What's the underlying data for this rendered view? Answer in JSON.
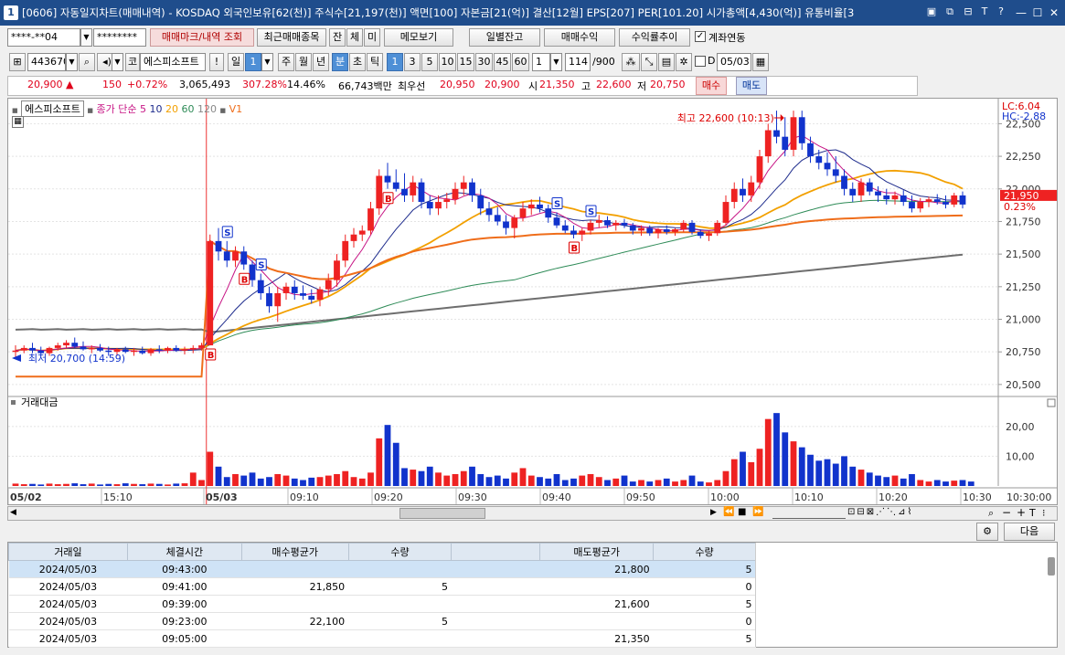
{
  "title": {
    "text": "[0606] 자동일지차트(매매내역) - KOSDAQ 외국인보유[62(천)] 주식수[21,197(천)] 액면[100] 자본금[21(억)] 결산[12월] EPS[207] PER[101.20] 시가총액[4,430(억)] 유통비율[3",
    "app_number": "1"
  },
  "toolbar1": {
    "account": "****-**04",
    "password": "********",
    "btn_markers": "매매마크/내역 조회",
    "btn_recent": "최근매매종목",
    "btn_jan": "잔",
    "btn_che": "체",
    "btn_mi": "미",
    "btn_memo": "메모보기",
    "btn_daily": "일별잔고",
    "btn_profit": "매매수익",
    "btn_return": "수익률추이",
    "link_label": "계좌연동"
  },
  "toolbar2": {
    "code": "443670",
    "market": "코",
    "stock_name": "에스피소프트",
    "excl": "!",
    "day_label": "일",
    "day_val": "1",
    "week": "주",
    "month": "월",
    "year": "년",
    "minute": "분",
    "sec": "초",
    "tick": "틱",
    "periods": [
      "1",
      "3",
      "5",
      "10",
      "15",
      "30",
      "45",
      "60"
    ],
    "count": "1",
    "bars": "114",
    "total_bars": "/900",
    "d_label": "D",
    "date": "05/03"
  },
  "pricebar": {
    "price": "20,900",
    "arrow": "▲",
    "change": "150",
    "pct": "+0.72%",
    "volume": "3,065,493",
    "vol_ratio": "307.28%",
    "turnover": "14.46%",
    "amount": "66,743백만",
    "best_label": "최우선",
    "ask": "20,950",
    "bid": "20,900",
    "open_label": "시",
    "open": "21,350",
    "high_label": "고",
    "high": "22,600",
    "low_label": "저",
    "low": "20,750",
    "buy": "매수",
    "sell": "매도"
  },
  "chart_header": {
    "stock": "에스피소프트",
    "ma_label": "종가 단순",
    "ma": [
      "5",
      "10",
      "20",
      "60",
      "120"
    ],
    "v1": "V1",
    "lc": "LC:6.04",
    "hc": "HC:-2.88",
    "high_note": "최고 22,600 (10:13)",
    "low_note": "최저 20,700 (14:59)",
    "cur_price": "21,950",
    "cur_pct": "0.23%",
    "vol_title": "거래대금"
  },
  "colors": {
    "up": "#ee2222",
    "down": "#1133cc",
    "ma5": "#c71585",
    "ma10": "#1d2b8c",
    "ma20": "#f2a000",
    "ma60": "#2e8b57",
    "ma120": "#6e6e6e",
    "vwap": "#ef6d1a"
  },
  "chart_data": {
    "type": "candlestick",
    "y_ticks": [
      "22,500",
      "22,250",
      "22,000",
      "21,750",
      "21,500",
      "21,250",
      "21,000",
      "20,750",
      "20,500"
    ],
    "ylim": [
      20450,
      22650
    ],
    "vol_ticks": [
      "20,00",
      "10,00"
    ],
    "x_ticks": [
      "05/02",
      "15:10",
      "05/03",
      "09:10",
      "09:20",
      "09:30",
      "09:40",
      "09:50",
      "10:00",
      "10:10",
      "10:20",
      "10:30",
      "10:30:00"
    ],
    "candles": [
      [
        20750,
        20800,
        20700,
        20760
      ],
      [
        20760,
        20800,
        20740,
        20780
      ],
      [
        20780,
        20820,
        20740,
        20760
      ],
      [
        20760,
        20790,
        20720,
        20740
      ],
      [
        20740,
        20790,
        20720,
        20780
      ],
      [
        20780,
        20820,
        20760,
        20800
      ],
      [
        20800,
        20840,
        20780,
        20820
      ],
      [
        20820,
        20860,
        20780,
        20790
      ],
      [
        20790,
        20830,
        20760,
        20770
      ],
      [
        20770,
        20800,
        20740,
        20780
      ],
      [
        20780,
        20810,
        20750,
        20760
      ],
      [
        20760,
        20790,
        20720,
        20750
      ],
      [
        20750,
        20780,
        20720,
        20770
      ],
      [
        20770,
        20790,
        20740,
        20750
      ],
      [
        20750,
        20780,
        20720,
        20760
      ],
      [
        20760,
        20790,
        20730,
        20740
      ],
      [
        20740,
        20780,
        20720,
        20770
      ],
      [
        20770,
        20800,
        20740,
        20760
      ],
      [
        20760,
        20790,
        20740,
        20780
      ],
      [
        20780,
        20800,
        20750,
        20760
      ],
      [
        20760,
        20790,
        20730,
        20770
      ],
      [
        20770,
        20800,
        20740,
        20780
      ],
      [
        20780,
        20820,
        20760,
        20800
      ],
      [
        20800,
        21650,
        20800,
        21600
      ],
      [
        21600,
        21700,
        21450,
        21520
      ],
      [
        21520,
        21600,
        21400,
        21450
      ],
      [
        21450,
        21560,
        21400,
        21520
      ],
      [
        21520,
        21560,
        21380,
        21420
      ],
      [
        21420,
        21450,
        21250,
        21300
      ],
      [
        21300,
        21350,
        21150,
        21200
      ],
      [
        21200,
        21250,
        21050,
        21100
      ],
      [
        21100,
        21250,
        20980,
        21200
      ],
      [
        21200,
        21280,
        21150,
        21250
      ],
      [
        21250,
        21300,
        21150,
        21200
      ],
      [
        21200,
        21260,
        21150,
        21180
      ],
      [
        21180,
        21230,
        21120,
        21150
      ],
      [
        21150,
        21250,
        21100,
        21230
      ],
      [
        21230,
        21350,
        21180,
        21300
      ],
      [
        21300,
        21500,
        21250,
        21450
      ],
      [
        21450,
        21650,
        21400,
        21600
      ],
      [
        21600,
        21700,
        21550,
        21650
      ],
      [
        21650,
        21720,
        21600,
        21680
      ],
      [
        21680,
        21900,
        21650,
        21850
      ],
      [
        21850,
        22150,
        21800,
        22100
      ],
      [
        22100,
        22200,
        22000,
        22050
      ],
      [
        22050,
        22150,
        21980,
        22000
      ],
      [
        22000,
        22120,
        21900,
        21950
      ],
      [
        21950,
        22100,
        21900,
        22050
      ],
      [
        22050,
        22080,
        21850,
        21900
      ],
      [
        21900,
        21950,
        21800,
        21850
      ],
      [
        21850,
        21950,
        21800,
        21900
      ],
      [
        21900,
        21970,
        21850,
        21920
      ],
      [
        21920,
        22050,
        21880,
        22000
      ],
      [
        22000,
        22100,
        21950,
        22050
      ],
      [
        22050,
        22080,
        21900,
        21950
      ],
      [
        21950,
        22000,
        21800,
        21850
      ],
      [
        21850,
        21900,
        21750,
        21800
      ],
      [
        21800,
        21860,
        21720,
        21750
      ],
      [
        21750,
        21800,
        21650,
        21700
      ],
      [
        21700,
        21800,
        21620,
        21780
      ],
      [
        21780,
        21900,
        21750,
        21850
      ],
      [
        21850,
        21920,
        21800,
        21880
      ],
      [
        21880,
        21940,
        21820,
        21850
      ],
      [
        21850,
        21880,
        21740,
        21780
      ],
      [
        21780,
        21820,
        21700,
        21720
      ],
      [
        21720,
        21760,
        21660,
        21680
      ],
      [
        21680,
        21720,
        21620,
        21650
      ],
      [
        21650,
        21700,
        21600,
        21680
      ],
      [
        21680,
        21760,
        21650,
        21740
      ],
      [
        21740,
        21800,
        21700,
        21760
      ],
      [
        21760,
        21790,
        21700,
        21720
      ],
      [
        21720,
        21760,
        21680,
        21740
      ],
      [
        21740,
        21770,
        21700,
        21720
      ],
      [
        21720,
        21740,
        21650,
        21680
      ],
      [
        21680,
        21720,
        21640,
        21700
      ],
      [
        21700,
        21720,
        21640,
        21660
      ],
      [
        21660,
        21700,
        21620,
        21690
      ],
      [
        21690,
        21720,
        21650,
        21670
      ],
      [
        21670,
        21700,
        21640,
        21690
      ],
      [
        21690,
        21760,
        21670,
        21740
      ],
      [
        21740,
        21760,
        21650,
        21670
      ],
      [
        21670,
        21690,
        21620,
        21640
      ],
      [
        21640,
        21680,
        21600,
        21660
      ],
      [
        21660,
        21760,
        21640,
        21740
      ],
      [
        21740,
        21950,
        21720,
        21900
      ],
      [
        21900,
        22050,
        21850,
        22000
      ],
      [
        22000,
        22080,
        21900,
        21950
      ],
      [
        21950,
        22100,
        21900,
        22050
      ],
      [
        22050,
        22300,
        22000,
        22250
      ],
      [
        22250,
        22500,
        22200,
        22450
      ],
      [
        22450,
        22600,
        22350,
        22400
      ],
      [
        22400,
        22550,
        22250,
        22300
      ],
      [
        22300,
        22600,
        22250,
        22550
      ],
      [
        22550,
        22600,
        22300,
        22350
      ],
      [
        22350,
        22400,
        22200,
        22250
      ],
      [
        22250,
        22300,
        22150,
        22200
      ],
      [
        22200,
        22280,
        22100,
        22150
      ],
      [
        22150,
        22250,
        22050,
        22100
      ],
      [
        22100,
        22150,
        21950,
        22000
      ],
      [
        22000,
        22050,
        21900,
        21950
      ],
      [
        21950,
        22080,
        21900,
        22050
      ],
      [
        22050,
        22080,
        21950,
        21980
      ],
      [
        21980,
        22020,
        21900,
        21950
      ],
      [
        21950,
        22000,
        21880,
        21920
      ],
      [
        21920,
        21980,
        21880,
        21950
      ],
      [
        21950,
        21990,
        21870,
        21900
      ],
      [
        21900,
        21950,
        21820,
        21850
      ],
      [
        21850,
        21930,
        21820,
        21900
      ],
      [
        21900,
        21940,
        21860,
        21920
      ],
      [
        21920,
        21960,
        21880,
        21900
      ],
      [
        21900,
        21950,
        21850,
        21880
      ],
      [
        21880,
        21970,
        21860,
        21950
      ],
      [
        21950,
        21980,
        21850,
        21880
      ]
    ],
    "volumes": [
      0.8,
      0.6,
      0.7,
      0.5,
      0.8,
      0.6,
      0.7,
      0.9,
      0.6,
      0.8,
      0.5,
      0.7,
      0.6,
      0.9,
      0.7,
      0.6,
      0.8,
      0.7,
      0.5,
      0.8,
      0.9,
      4.5,
      2.0,
      11.5,
      6.5,
      3.0,
      4.0,
      3.5,
      4.5,
      2.5,
      3.0,
      4.0,
      3.5,
      2.5,
      2.0,
      2.8,
      3.0,
      3.5,
      4.0,
      5.0,
      3.0,
      2.5,
      4.5,
      16.0,
      20.5,
      14.5,
      6.0,
      5.5,
      5.0,
      6.5,
      4.5,
      3.5,
      4.0,
      5.0,
      6.5,
      4.0,
      3.0,
      3.5,
      2.5,
      4.5,
      6.0,
      3.5,
      3.0,
      2.5,
      4.0,
      2.0,
      2.5,
      3.5,
      4.0,
      3.0,
      2.0,
      2.5,
      3.5,
      1.5,
      2.0,
      1.5,
      2.0,
      2.5,
      1.5,
      2.0,
      3.5,
      1.5,
      1.2,
      2.0,
      5.0,
      9.0,
      11.5,
      8.0,
      12.5,
      22.5,
      24.5,
      18.0,
      15.0,
      13.0,
      10.5,
      8.5,
      9.0,
      7.5,
      10.0,
      6.5,
      5.5,
      4.5,
      3.5,
      3.0,
      3.5,
      2.5,
      4.0,
      2.0,
      1.5,
      2.0,
      1.5,
      1.8,
      2.0,
      1.5
    ],
    "markers": [
      {
        "label": "B",
        "type": "buy",
        "i": 23
      },
      {
        "label": "S",
        "type": "sell",
        "i": 25
      },
      {
        "label": "B",
        "type": "buy",
        "i": 27
      },
      {
        "label": "S",
        "type": "sell",
        "i": 29
      },
      {
        "label": "B",
        "type": "buy",
        "i": 44
      },
      {
        "label": "S",
        "type": "sell",
        "i": 64
      },
      {
        "label": "B",
        "type": "buy",
        "i": 66
      },
      {
        "label": "S",
        "type": "sell",
        "i": 68
      }
    ]
  },
  "scroll_dates": "",
  "grid": {
    "settings_icon": "gear-icon",
    "next": "다음",
    "headers": [
      "거래일",
      "체결시간",
      "매수평균가",
      "수량",
      "",
      "매도평균가",
      "수량"
    ],
    "rows": [
      [
        "2024/05/03",
        "09:43:00",
        "",
        "",
        "",
        "21,800",
        "5"
      ],
      [
        "2024/05/03",
        "09:41:00",
        "21,850",
        "5",
        "",
        "",
        "0"
      ],
      [
        "2024/05/03",
        "09:39:00",
        "",
        "",
        "",
        "21,600",
        "5"
      ],
      [
        "2024/05/03",
        "09:23:00",
        "22,100",
        "5",
        "",
        "",
        "0"
      ],
      [
        "2024/05/03",
        "09:05:00",
        "",
        "",
        "",
        "21,350",
        "5"
      ]
    ]
  }
}
